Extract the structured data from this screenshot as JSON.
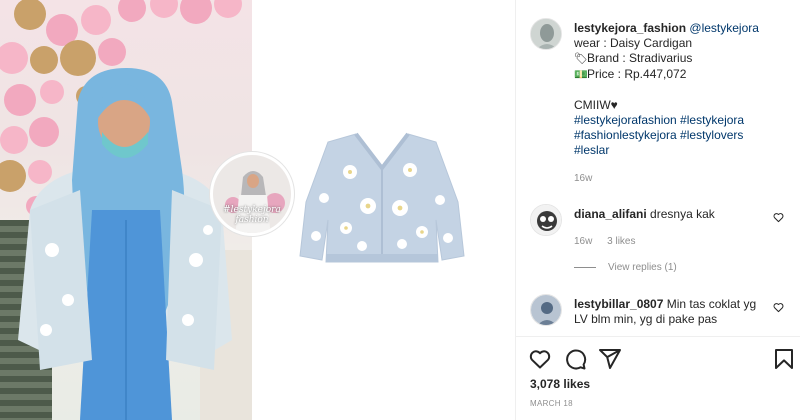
{
  "post": {
    "author_username": "lestykejora_fashion",
    "author_handle": "@lestykejora",
    "caption_lines": [
      {
        "icon": "",
        "text": "wear : Daisy Cardigan"
      },
      {
        "icon": "tag-icon",
        "text": "Brand : Stradivarius"
      },
      {
        "icon": "price-tag-icon",
        "text": "Price : Rp.447,072"
      }
    ],
    "cmiiw": "CMIIW",
    "hashtags": [
      "#lestykejorafashion #lestykejora",
      "#fashionlestykejora #lestylovers",
      "#leslar"
    ],
    "caption_time": "16w",
    "photo_inset_text": [
      "#lestykejora",
      "fashion"
    ]
  },
  "comments": [
    {
      "username": "diana_alifani",
      "text": "dresnya kak",
      "time": "16w",
      "likes": "3 likes",
      "view_replies": "View replies (1)",
      "heart_icon": "heart-outline-icon"
    },
    {
      "username": "lestybillar_0807",
      "text": "Min tas coklat yg LV blm min, yg di pake pas",
      "heart_icon": "heart-outline-icon"
    }
  ],
  "actions": {
    "icons": [
      "heart-outline-icon",
      "comment-icon",
      "share-icon",
      "bookmark-icon"
    ],
    "likes": "3,078 likes",
    "date": "MARCH 18"
  },
  "colors": {
    "link": "#00376b",
    "text": "#262626",
    "muted": "#8e8e8e",
    "border": "#efefef"
  }
}
